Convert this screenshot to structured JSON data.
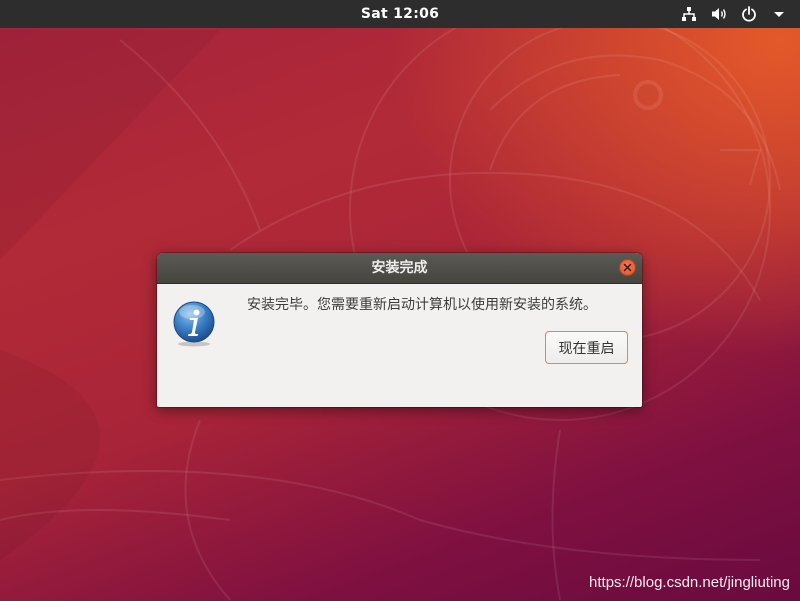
{
  "topbar": {
    "clock": "Sat 12:06",
    "tray_icons": [
      "network-icon",
      "volume-icon",
      "power-icon",
      "chevron-down-icon"
    ]
  },
  "dialog": {
    "title": "安装完成",
    "message": "安装完毕。您需要重新启动计算机以使用新安装的系统。",
    "restart_label": "现在重启",
    "icon": "info-icon"
  },
  "watermark": "https://blog.csdn.net/jingliuting",
  "colors": {
    "topbar_bg": "#2d2d2d",
    "dialog_bg": "#f2f1f0",
    "titlebar_bg": "#4f4e49",
    "close_button": "#e95420",
    "button_border": "#e4835f",
    "info_icon_blue": "#2f6fb3"
  }
}
